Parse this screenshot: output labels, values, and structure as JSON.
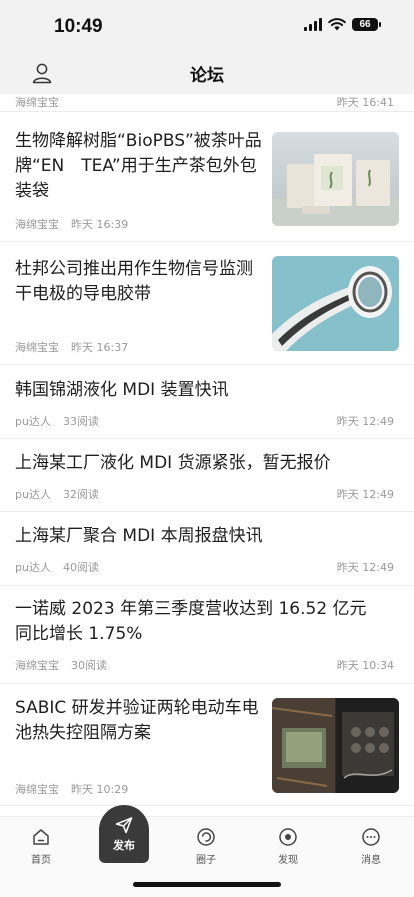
{
  "status_bar": {
    "time": "10:49",
    "battery": "66"
  },
  "nav": {
    "title": "论坛"
  },
  "top_partial": {
    "author": "海绵宝宝",
    "time": "昨天 16:41"
  },
  "articles": [
    {
      "title": "生物降解树脂“BioPBS”被茶叶品牌“EN　TEA”用于生产茶包外包装袋",
      "author": "海绵宝宝",
      "views": "",
      "time": "昨天 16:39",
      "right_time": ""
    },
    {
      "title": "杜邦公司推出用作生物信号监测干电极的导电胶带",
      "author": "海绵宝宝",
      "views": "",
      "time": "昨天 16:37",
      "right_time": ""
    },
    {
      "title": "韩国锦湖液化 MDI 装置快讯",
      "author": "pu达人",
      "views": "33阅读",
      "time": "",
      "right_time": "昨天 12:49"
    },
    {
      "title": "上海某工厂液化 MDI 货源紧张，暂无报价",
      "author": "pu达人",
      "views": "32阅读",
      "time": "",
      "right_time": "昨天 12:49"
    },
    {
      "title": "上海某厂聚合 MDI 本周报盘快讯",
      "author": "pu达人",
      "views": "40阅读",
      "time": "",
      "right_time": "昨天 12:49"
    },
    {
      "title": "一诺威 2023 年第三季度营收达到 16.52 亿元　同比增长 1.75%",
      "author": "海绵宝宝",
      "views": "30阅读",
      "time": "",
      "right_time": "昨天 10:34"
    },
    {
      "title": "SABIC 研发并验证两轮电动车电池热失控阻隔方案",
      "author": "海绵宝宝",
      "views": "",
      "time": "昨天 10:29",
      "right_time": ""
    }
  ],
  "tabs": [
    {
      "label": "首页",
      "icon": "home-icon"
    },
    {
      "label": "发布",
      "icon": "send-icon"
    },
    {
      "label": "圈子",
      "icon": "circle-icon"
    },
    {
      "label": "发现",
      "icon": "discover-icon"
    },
    {
      "label": "消息",
      "icon": "message-icon"
    }
  ],
  "colors": {
    "nav_bg": "#f2f2f2",
    "publish_bg": "#3a3a3a",
    "meta_text": "#9a9a9a"
  }
}
